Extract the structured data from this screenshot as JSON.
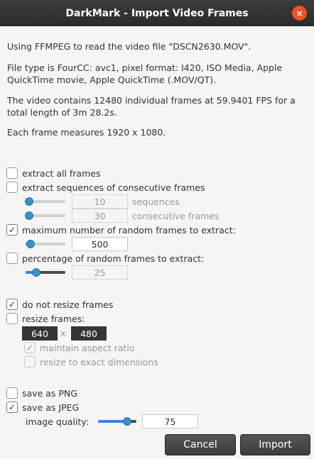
{
  "window": {
    "title": "DarkMark - Import Video Frames",
    "close_icon": "×"
  },
  "info": {
    "line1": "Using FFMPEG to read the video file \"DSCN2630.MOV\".",
    "line2": "File type is FourCC: avc1, pixel format: I420, ISO Media, Apple QuickTime movie, Apple QuickTime (.MOV/QT).",
    "line3": "The video contains 12480 individual frames at 59.9401 FPS for a total length of 3m 28.2s.",
    "line4": "Each frame measures 1920 x 1080."
  },
  "extract": {
    "all_frames": {
      "label": "extract all frames",
      "checked": false
    },
    "sequences": {
      "label": "extract sequences of consecutive frames",
      "checked": false,
      "sequences_value": "10",
      "sequences_label": "sequences",
      "consecutive_value": "30",
      "consecutive_label": "consecutive frames"
    },
    "max_random": {
      "label": "maximum number of random frames to extract:",
      "checked": true,
      "value": "500"
    },
    "percentage": {
      "label": "percentage of random frames to extract:",
      "checked": false,
      "value": "25"
    }
  },
  "resize": {
    "do_not_resize": {
      "label": "do not resize frames",
      "checked": true
    },
    "resize_frames": {
      "label": "resize frames:",
      "checked": false
    },
    "width": "640",
    "separator": "x",
    "height": "480",
    "maintain_aspect": {
      "label": "maintain aspect ratio",
      "checked": true
    },
    "exact_dimensions": {
      "label": "resize to exact dimensions",
      "checked": false
    }
  },
  "output": {
    "png": {
      "label": "save as PNG",
      "checked": false
    },
    "jpeg": {
      "label": "save as JPEG",
      "checked": true
    },
    "quality_label": "image quality:",
    "quality_value": "75",
    "quality_fraction": 0.75
  },
  "buttons": {
    "cancel": "Cancel",
    "import": "Import"
  },
  "check_glyph": "✓"
}
